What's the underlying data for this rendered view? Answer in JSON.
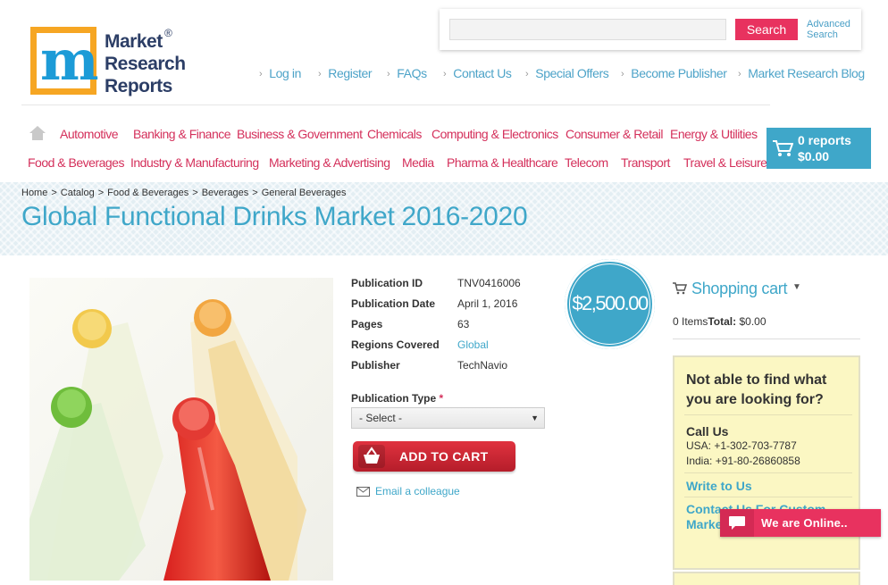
{
  "logo": {
    "line1": "Market",
    "line2": "Research",
    "line3": "Reports",
    "reg": "®"
  },
  "search": {
    "button": "Search",
    "advanced": "Advanced Search",
    "placeholder": ""
  },
  "top_nav": [
    "Log in",
    "Register",
    "FAQs",
    "Contact Us",
    "Special Offers",
    "Become Publisher",
    "Market Research Blog"
  ],
  "categories": {
    "row1": [
      "Automotive",
      "Banking & Finance",
      "Business & Government",
      "Chemicals",
      "Computing & Electronics",
      "Consumer & Retail",
      "Energy & Utilities"
    ],
    "row2": [
      "Food & Beverages",
      "Industry & Manufacturing",
      "Marketing & Advertising",
      "Media",
      "Pharma & Healthcare",
      "Telecom",
      "Transport",
      "Travel & Leisure"
    ]
  },
  "cart_button": {
    "reports": "0 reports",
    "total": "$0.00"
  },
  "breadcrumb": [
    "Home",
    "Catalog",
    "Food & Beverages",
    "Beverages",
    "General Beverages"
  ],
  "breadcrumb_sep": ">",
  "page_title": "Global Functional Drinks Market 2016-2020",
  "product": {
    "details": [
      {
        "label": "Publication ID",
        "value": "TNV0416006"
      },
      {
        "label": "Publication Date",
        "value": "April 1, 2016"
      },
      {
        "label": "Pages",
        "value": "63"
      },
      {
        "label": "Regions Covered",
        "value": "Global"
      },
      {
        "label": "Publisher",
        "value": "TechNavio"
      }
    ],
    "price": "$2,500.00",
    "publication_type_label": "Publication Type",
    "required_mark": "*",
    "select_value": "- Select -",
    "add_to_cart": "ADD TO CART",
    "email_colleague": "Email a colleague"
  },
  "sidebar": {
    "shopping_cart_title": "Shopping cart",
    "items_label": "0 Items",
    "total_label": "Total:",
    "total_value": "$0.00",
    "help_title": "Not able to find what you are looking for?",
    "call_us": "Call Us",
    "phone_usa": "USA: +1-302-703-7787",
    "phone_india": "India: +91-80-26860858",
    "write_us": "Write to Us",
    "contact_custom": "Contact Us For Custom Market"
  },
  "chat": {
    "label": "We are Online.."
  },
  "colors": {
    "accent": "#3fa7c9",
    "brand_pink": "#e8325f",
    "category_red": "#d4305b",
    "logo_orange": "#f6a623"
  }
}
